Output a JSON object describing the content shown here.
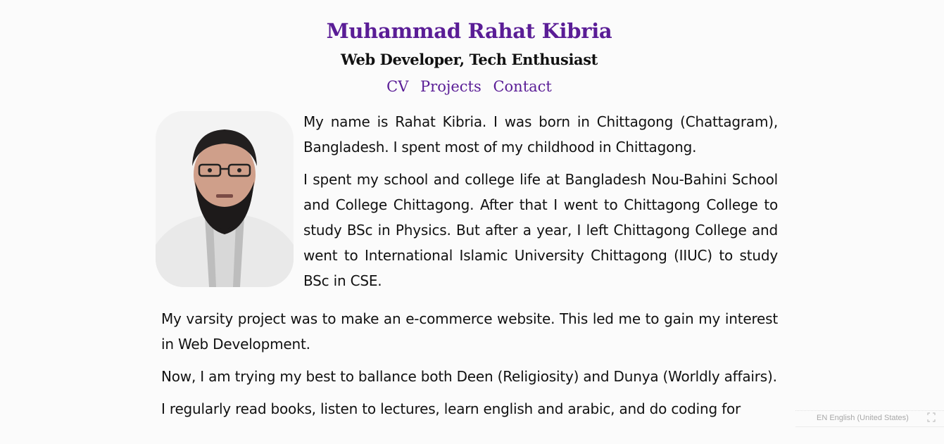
{
  "header": {
    "name": "Muhammad Rahat Kibria",
    "subtitle": "Web Developer, Tech Enthusiast",
    "nav": [
      "CV",
      "Projects",
      "Contact"
    ]
  },
  "bio": {
    "paragraphs": [
      "My name is Rahat Kibria. I was born in Chittagong (Chattagram), Bangladesh. I spent most of my childhood in Chittagong.",
      "I spent my school and college life at Bangladesh Nou-Bahini School and College Chittagong. After that I went to Chittagong College to study BSc in Physics. But after a year, I left Chittagong College and went to International Islamic University Chittagong (IIUC) to study BSc in CSE.",
      "My varsity project was to make an e-commerce website. This led me to gain my interest in Web Development.",
      "Now, I am trying my best to ballance both Deen (Religiosity) and Dunya (Worldly affairs).",
      "I regularly read books, listen to lectures, learn english and arabic, and do coding for"
    ]
  },
  "language_bar": {
    "label": "EN English (United States)"
  },
  "colors": {
    "accent": "#5a1d96",
    "background": "#fbfbfb",
    "text": "#111111"
  }
}
